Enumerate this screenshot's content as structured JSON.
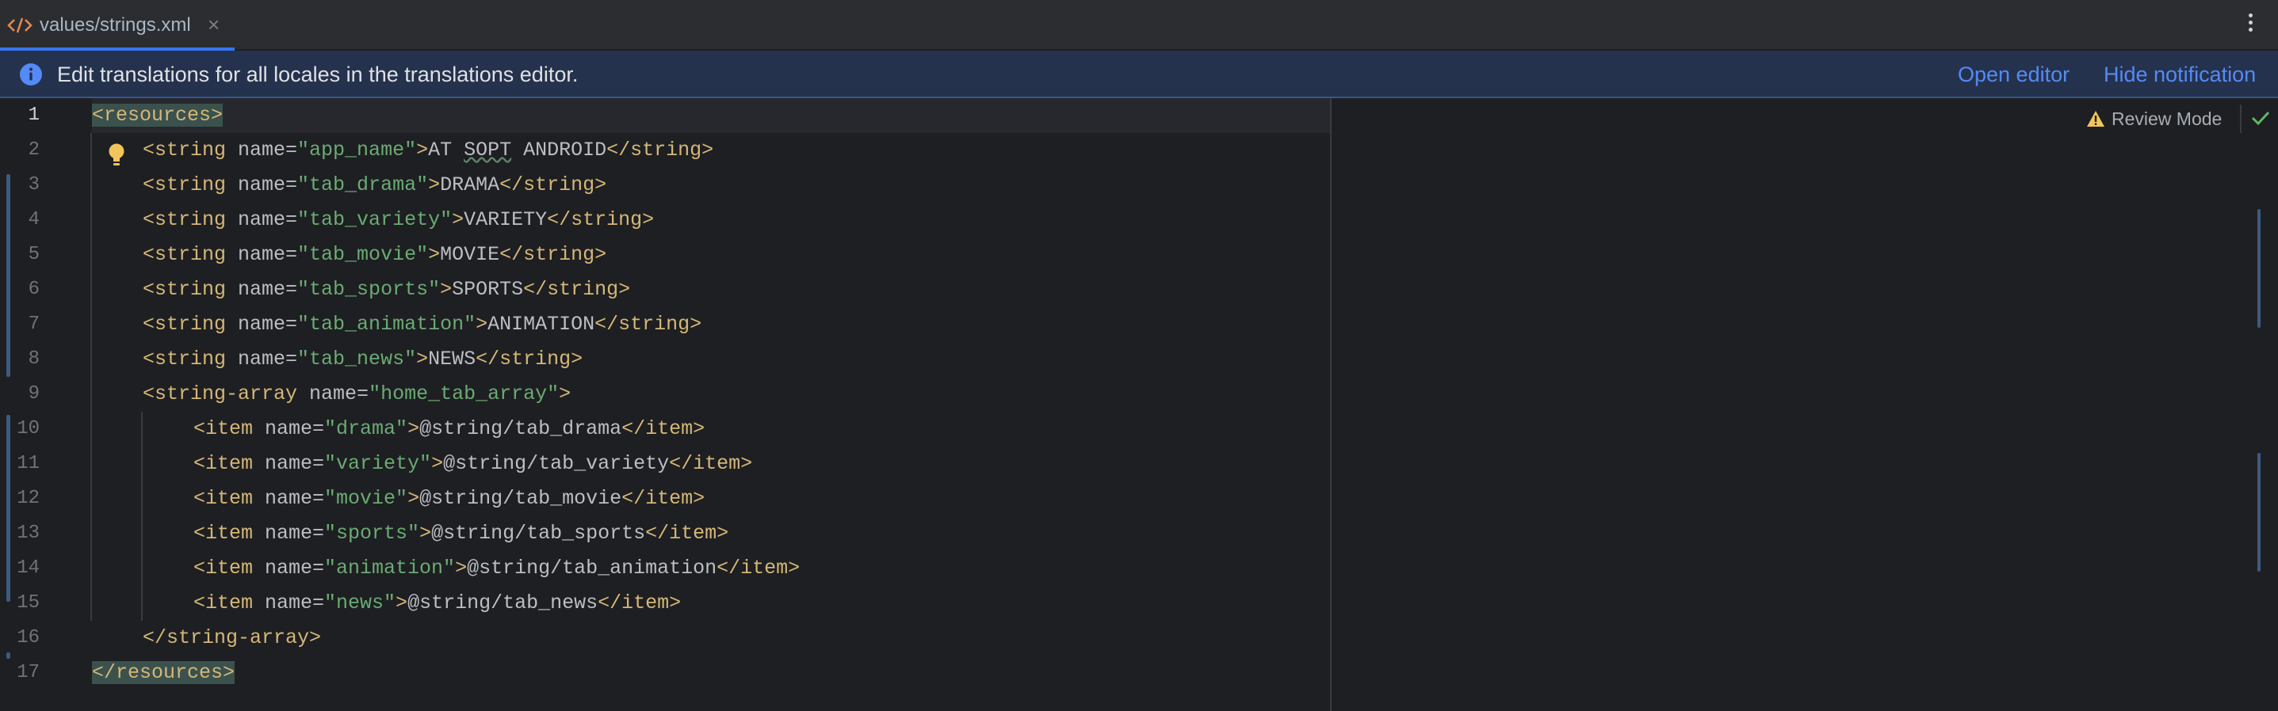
{
  "tab": {
    "label": "values/strings.xml",
    "close": "×"
  },
  "notification": {
    "text": "Edit translations for all locales in the translations editor.",
    "open_editor": "Open editor",
    "hide_notification": "Hide notification"
  },
  "review_mode": "Review Mode",
  "line_numbers": [
    "1",
    "2",
    "3",
    "4",
    "5",
    "6",
    "7",
    "8",
    "9",
    "10",
    "11",
    "12",
    "13",
    "14",
    "15",
    "16",
    "17"
  ],
  "code": {
    "l1": {
      "tag": "<resources>"
    },
    "l2": {
      "open": "<string ",
      "attr": "name=",
      "val": "\"app_name\"",
      "gt": ">",
      "text_a": "AT ",
      "text_b": "SOPT",
      "text_c": " ANDROID",
      "close": "</string>"
    },
    "l3": {
      "open": "<string ",
      "attr": "name=",
      "val": "\"tab_drama\"",
      "gt": ">",
      "text": "DRAMA",
      "close": "</string>"
    },
    "l4": {
      "open": "<string ",
      "attr": "name=",
      "val": "\"tab_variety\"",
      "gt": ">",
      "text": "VARIETY",
      "close": "</string>"
    },
    "l5": {
      "open": "<string ",
      "attr": "name=",
      "val": "\"tab_movie\"",
      "gt": ">",
      "text": "MOVIE",
      "close": "</string>"
    },
    "l6": {
      "open": "<string ",
      "attr": "name=",
      "val": "\"tab_sports\"",
      "gt": ">",
      "text": "SPORTS",
      "close": "</string>"
    },
    "l7": {
      "open": "<string ",
      "attr": "name=",
      "val": "\"tab_animation\"",
      "gt": ">",
      "text": "ANIMATION",
      "close": "</string>"
    },
    "l8": {
      "open": "<string ",
      "attr": "name=",
      "val": "\"tab_news\"",
      "gt": ">",
      "text": "NEWS",
      "close": "</string>"
    },
    "l9": {
      "open": "<string-array ",
      "attr": "name=",
      "val": "\"home_tab_array\"",
      "gt": ">"
    },
    "l10": {
      "open": "<item ",
      "attr": "name=",
      "val": "\"drama\"",
      "gt": ">",
      "text": "@string/tab_drama",
      "close": "</item>"
    },
    "l11": {
      "open": "<item ",
      "attr": "name=",
      "val": "\"variety\"",
      "gt": ">",
      "text": "@string/tab_variety",
      "close": "</item>"
    },
    "l12": {
      "open": "<item ",
      "attr": "name=",
      "val": "\"movie\"",
      "gt": ">",
      "text": "@string/tab_movie",
      "close": "</item>"
    },
    "l13": {
      "open": "<item ",
      "attr": "name=",
      "val": "\"sports\"",
      "gt": ">",
      "text": "@string/tab_sports",
      "close": "</item>"
    },
    "l14": {
      "open": "<item ",
      "attr": "name=",
      "val": "\"animation\"",
      "gt": ">",
      "text": "@string/tab_animation",
      "close": "</item>"
    },
    "l15": {
      "open": "<item ",
      "attr": "name=",
      "val": "\"news\"",
      "gt": ">",
      "text": "@string/tab_news",
      "close": "</item>"
    },
    "l16": {
      "tag": "</string-array>"
    },
    "l17": {
      "tag": "</resources>"
    }
  },
  "colors": {
    "accent": "#3574f0",
    "tag": "#d5b778",
    "attr_value": "#6aab73",
    "link": "#548af7",
    "background": "#1e1f22"
  },
  "icons": [
    "xml-file-icon",
    "close-icon",
    "more-options-icon",
    "info-icon",
    "lightbulb-icon",
    "warning-icon",
    "check-icon"
  ]
}
